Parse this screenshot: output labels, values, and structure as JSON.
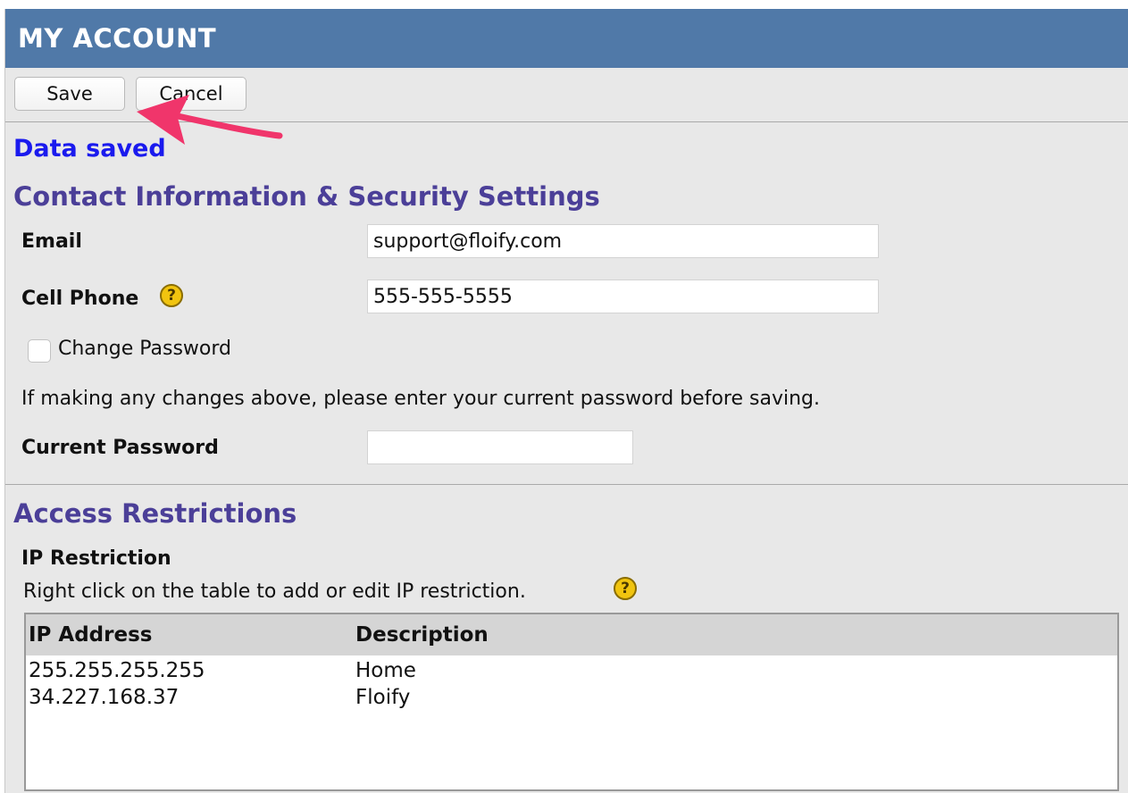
{
  "header": {
    "title": "MY ACCOUNT",
    "color": "#5079a8"
  },
  "toolbar": {
    "save_label": "Save",
    "cancel_label": "Cancel"
  },
  "status": {
    "message": "Data saved",
    "color": "#1a1aee"
  },
  "contact": {
    "heading": "Contact Information & Security Settings",
    "email_label": "Email",
    "email_value": "support@floify.com",
    "phone_label": "Cell Phone",
    "phone_value": "555-555-5555",
    "change_password_label": "Change Password",
    "change_password_checked": false,
    "note": "If making any changes above, please enter your current password before saving.",
    "current_password_label": "Current Password",
    "current_password_value": ""
  },
  "access": {
    "heading": "Access Restrictions",
    "ip_title": "IP Restriction",
    "ip_hint": "Right click on the table to add or edit IP restriction.",
    "columns": [
      "IP Address",
      "Description"
    ],
    "rows": [
      {
        "ip": "255.255.255.255",
        "description": "Home"
      },
      {
        "ip": "34.227.168.37",
        "description": "Floify"
      }
    ]
  },
  "icons": {
    "help": "?"
  },
  "annotation": {
    "arrow_color": "#f0356b"
  }
}
